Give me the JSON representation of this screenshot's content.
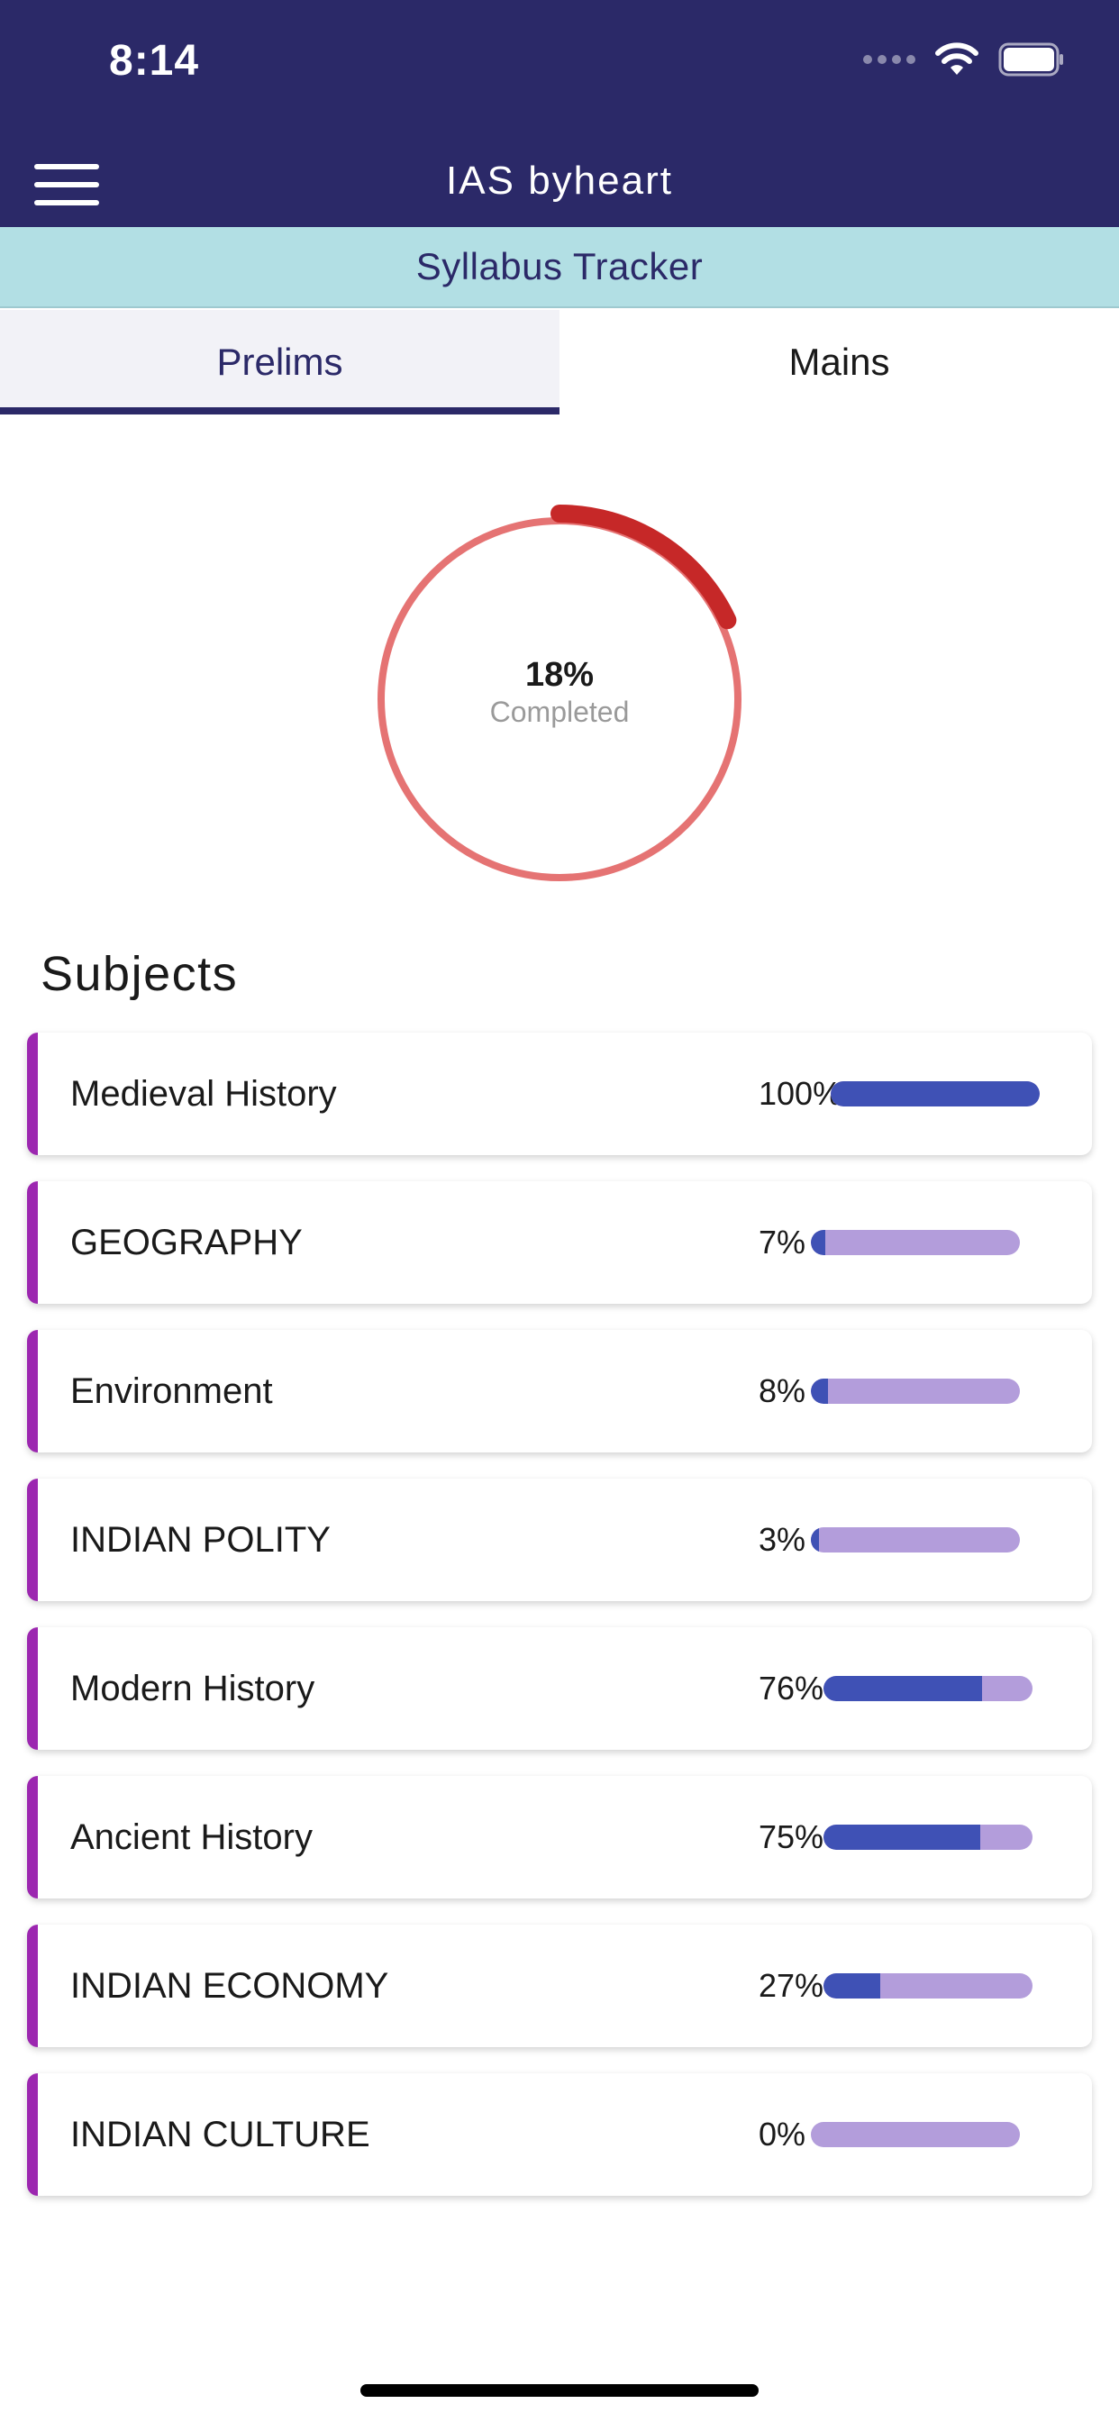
{
  "status_bar": {
    "time": "8:14",
    "icons": [
      "signal-icon",
      "wifi-icon",
      "battery-icon"
    ]
  },
  "header": {
    "title": "IAS byheart",
    "menu_icon": "hamburger-menu-icon"
  },
  "subheader": {
    "title": "Syllabus Tracker"
  },
  "tabs": [
    {
      "label": "Prelims",
      "active": true
    },
    {
      "label": "Mains",
      "active": false
    }
  ],
  "overall_progress": {
    "percent_text": "18%",
    "label": "Completed",
    "value": 0.18
  },
  "subjects": {
    "heading": "Subjects",
    "items": [
      {
        "name": "Medieval History",
        "percent_text": "100%",
        "value": 1.0
      },
      {
        "name": "GEOGRAPHY",
        "percent_text": "7%",
        "value": 0.07
      },
      {
        "name": "Environment",
        "percent_text": "8%",
        "value": 0.08
      },
      {
        "name": "INDIAN POLITY",
        "percent_text": "3%",
        "value": 0.03
      },
      {
        "name": "Modern History",
        "percent_text": "76%",
        "value": 0.76
      },
      {
        "name": "Ancient History",
        "percent_text": "75%",
        "value": 0.75
      },
      {
        "name": "INDIAN ECONOMY",
        "percent_text": "27%",
        "value": 0.27
      },
      {
        "name": "INDIAN CULTURE",
        "percent_text": "0%",
        "value": 0.0
      }
    ]
  },
  "colors": {
    "header_bg": "#2b2968",
    "subheader_bg": "#b2dfe4",
    "accent_purple": "#9c27b0",
    "bar_fill": "#3f51b5",
    "bar_track": "#b39ddb",
    "ring_track": "#e57373",
    "ring_progress": "#c62828"
  }
}
